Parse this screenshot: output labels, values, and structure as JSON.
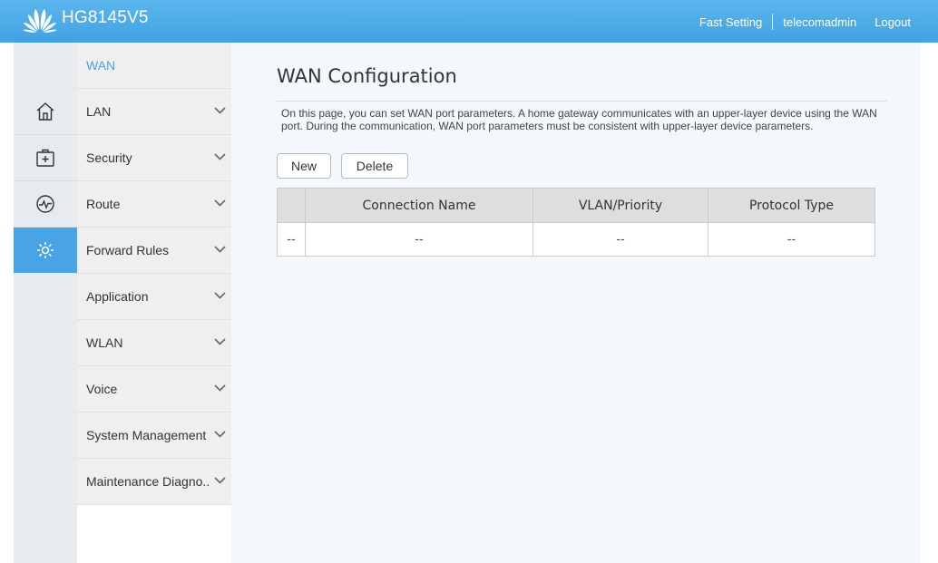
{
  "header": {
    "product_name": "HG8145V5",
    "fast_setting": "Fast Setting",
    "username": "telecomadmin",
    "logout": "Logout"
  },
  "icon_nav": {
    "items": [
      {
        "icon": "home-icon"
      },
      {
        "icon": "medical-kit-icon"
      },
      {
        "icon": "pulse-icon"
      },
      {
        "icon": "gear-icon",
        "active": true
      }
    ]
  },
  "menu": {
    "items": [
      {
        "label": "WAN",
        "current": true
      },
      {
        "label": "LAN"
      },
      {
        "label": "Security"
      },
      {
        "label": "Route"
      },
      {
        "label": "Forward Rules"
      },
      {
        "label": "Application"
      },
      {
        "label": "WLAN"
      },
      {
        "label": "Voice"
      },
      {
        "label": "System Management"
      },
      {
        "label": "Maintenance Diagno.."
      }
    ]
  },
  "main": {
    "title": "WAN Configuration",
    "description": "On this page, you can set WAN port parameters. A home gateway communicates with an upper-layer device using the WAN port. During the communication, WAN port parameters must be consistent with upper-layer device parameters.",
    "new_label": "New",
    "delete_label": "Delete",
    "table": {
      "headers": [
        "",
        "Connection Name",
        "VLAN/Priority",
        "Protocol Type"
      ],
      "rows": [
        [
          "--",
          "--",
          "--",
          "--"
        ]
      ]
    }
  },
  "colors": {
    "header_blue": "#48a8e8",
    "active_blue": "#48a4e4",
    "link_blue": "#4aa3df"
  }
}
